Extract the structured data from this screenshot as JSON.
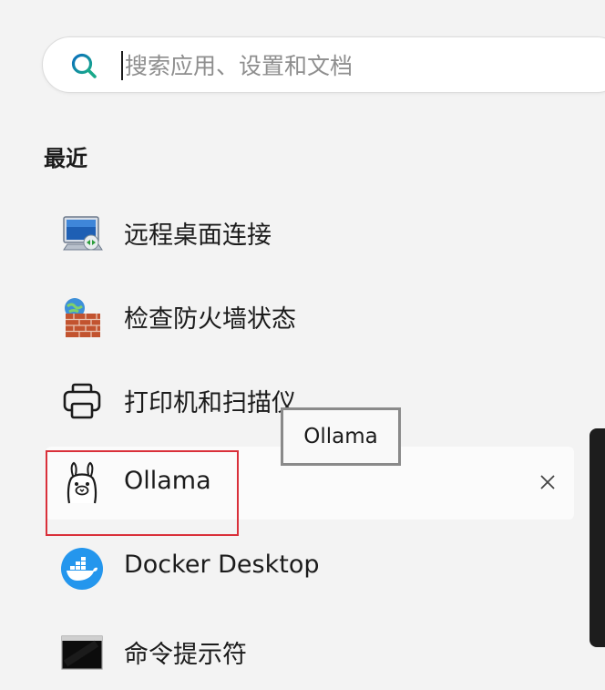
{
  "search": {
    "placeholder": "搜索应用、设置和文档",
    "value": ""
  },
  "recent": {
    "title": "最近",
    "items": [
      {
        "label": "远程桌面连接",
        "icon": "remote-desktop-icon"
      },
      {
        "label": "检查防火墙状态",
        "icon": "firewall-icon"
      },
      {
        "label": "打印机和扫描仪",
        "icon": "printer-icon"
      },
      {
        "label": "Ollama",
        "icon": "ollama-llama-icon",
        "remove_icon": "close-icon"
      },
      {
        "label": "Docker Desktop",
        "icon": "docker-whale-icon"
      },
      {
        "label": "命令提示符",
        "icon": "command-prompt-icon"
      }
    ]
  },
  "tooltip": {
    "text": "Ollama"
  },
  "colors": {
    "background": "#f3f3f3",
    "search_icon": "#0f7b8c",
    "highlight_border": "#d9303a",
    "docker_blue": "#2496ed"
  }
}
